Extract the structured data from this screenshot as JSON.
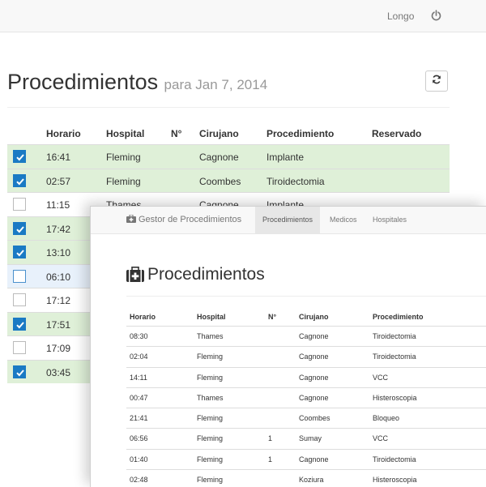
{
  "topbar": {
    "user": "Longo",
    "power_icon": "power-icon"
  },
  "page": {
    "title": "Procedimientos",
    "subtitle": "para Jan 7, 2014",
    "refresh_icon": "refresh-icon"
  },
  "back_table": {
    "headers": [
      "Horario",
      "Hospital",
      "N°",
      "Cirujano",
      "Procedimiento",
      "Reservado"
    ],
    "rows": [
      {
        "time": "16:41",
        "hospital": "Fleming",
        "num": "",
        "surgeon": "Cagnone",
        "procedure": "Implante",
        "state": "checked"
      },
      {
        "time": "02:57",
        "hospital": "Fleming",
        "num": "",
        "surgeon": "Coombes",
        "procedure": "Tiroidectomia",
        "state": "checked"
      },
      {
        "time": "11:15",
        "hospital": "Thames",
        "num": "",
        "surgeon": "Cagnone",
        "procedure": "Implante",
        "state": "unchecked"
      },
      {
        "time": "17:42",
        "hospital": "",
        "num": "",
        "surgeon": "",
        "procedure": "",
        "state": "checked"
      },
      {
        "time": "13:10",
        "hospital": "",
        "num": "",
        "surgeon": "",
        "procedure": "",
        "state": "checked"
      },
      {
        "time": "06:10",
        "hospital": "",
        "num": "",
        "surgeon": "",
        "procedure": "",
        "state": "focused"
      },
      {
        "time": "17:12",
        "hospital": "",
        "num": "",
        "surgeon": "",
        "procedure": "",
        "state": "unchecked"
      },
      {
        "time": "17:51",
        "hospital": "",
        "num": "",
        "surgeon": "",
        "procedure": "",
        "state": "checked"
      },
      {
        "time": "17:09",
        "hospital": "",
        "num": "",
        "surgeon": "",
        "procedure": "",
        "state": "unchecked"
      },
      {
        "time": "03:45",
        "hospital": "",
        "num": "",
        "surgeon": "",
        "procedure": "",
        "state": "checked"
      }
    ]
  },
  "front": {
    "brand": "Gestor de Procedimientos",
    "brand_icon": "medkit-icon",
    "nav": [
      "Procedimientos",
      "Medicos",
      "Hospitales"
    ],
    "title": "Procedimientos",
    "title_icon": "medkit-icon",
    "headers": [
      "Horario",
      "Hospital",
      "N°",
      "Cirujano",
      "Procedimiento"
    ],
    "rows": [
      {
        "time": "08:30",
        "hospital": "Thames",
        "num": "",
        "surgeon": "Cagnone",
        "procedure": "Tiroidectomia"
      },
      {
        "time": "02:04",
        "hospital": "Fleming",
        "num": "",
        "surgeon": "Cagnone",
        "procedure": "Tiroidectomia"
      },
      {
        "time": "14:11",
        "hospital": "Fleming",
        "num": "",
        "surgeon": "Cagnone",
        "procedure": "VCC"
      },
      {
        "time": "00:47",
        "hospital": "Thames",
        "num": "",
        "surgeon": "Cagnone",
        "procedure": "Histeroscopia"
      },
      {
        "time": "21:41",
        "hospital": "Fleming",
        "num": "",
        "surgeon": "Coombes",
        "procedure": "Bloqueo"
      },
      {
        "time": "06:56",
        "hospital": "Fleming",
        "num": "1",
        "surgeon": "Sumay",
        "procedure": "VCC"
      },
      {
        "time": "01:40",
        "hospital": "Fleming",
        "num": "1",
        "surgeon": "Cagnone",
        "procedure": "Tiroidectomia"
      },
      {
        "time": "02:48",
        "hospital": "Fleming",
        "num": "",
        "surgeon": "Koziura",
        "procedure": "Histeroscopia"
      }
    ]
  }
}
